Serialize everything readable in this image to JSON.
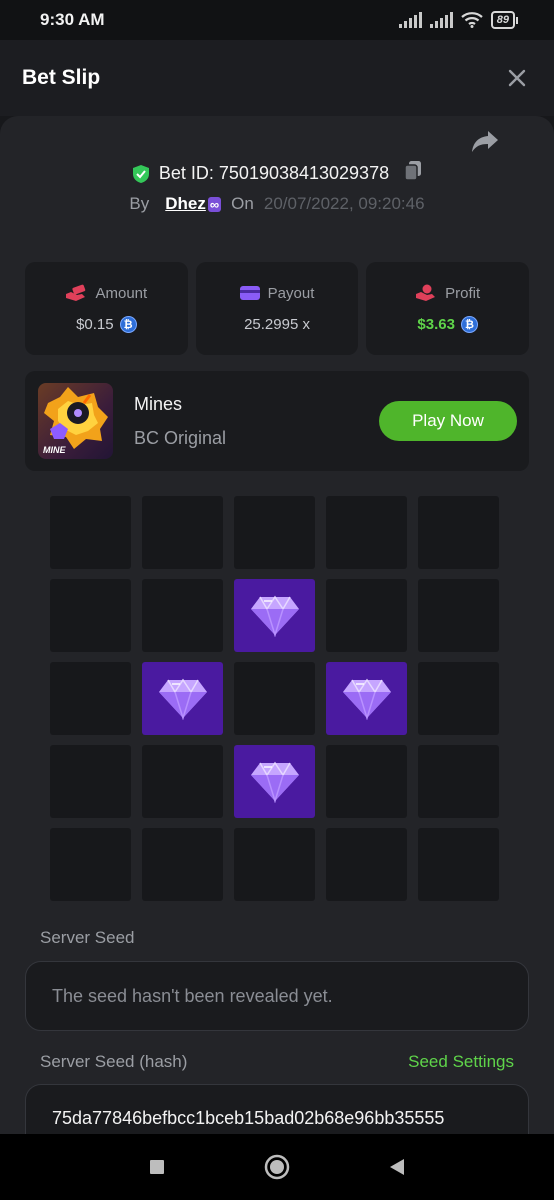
{
  "status_bar": {
    "time": "9:30 AM",
    "battery": "89"
  },
  "header": {
    "title": "Bet Slip"
  },
  "bet": {
    "id_text": "Bet ID: 75019038413029378",
    "by_label": "By",
    "username": "Dhez",
    "on_label": "On",
    "date": "20/07/2022, 09:20:46"
  },
  "stats": [
    {
      "label": "Amount",
      "value": "$0.15"
    },
    {
      "label": "Payout",
      "value": "25.2995 x"
    },
    {
      "label": "Profit",
      "value": "$3.63"
    }
  ],
  "game": {
    "name": "Mines",
    "subtitle": "BC Original",
    "play_label": "Play Now",
    "thumb_text": "MINE"
  },
  "mines_grid": {
    "rows": 5,
    "cols": 5,
    "cells": [
      0,
      0,
      0,
      0,
      0,
      0,
      0,
      1,
      0,
      0,
      0,
      1,
      0,
      1,
      0,
      0,
      0,
      1,
      0,
      0,
      0,
      0,
      0,
      0,
      0
    ]
  },
  "server_seed": {
    "label": "Server Seed",
    "value": "The seed hasn't been revealed yet."
  },
  "server_seed_hash": {
    "label": "Server Seed (hash)",
    "settings_label": "Seed Settings",
    "value": "75da77846befbcc1bceb15bad02b68e96bb35555"
  },
  "colors": {
    "accent": "#4fb52b",
    "gem_cell": "#4a1aa0",
    "panel": "#232428"
  }
}
